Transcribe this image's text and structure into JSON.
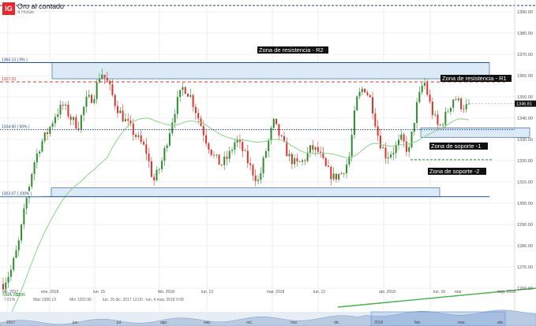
{
  "header": {
    "logo": "IG",
    "title": "Oro al contado",
    "timeframe": "4 Horas"
  },
  "stats": {
    "sma_label": "SMA 200",
    "sma_value": "1286",
    "change": "7,01%",
    "max": "Máx 1366.13",
    "min": "Mín 1252.90",
    "range": "lun. 15 dic. 2017 12:00 - lun. 4 may. 2018 0:00"
  },
  "colors": {
    "candle_up": "#2e8b2e",
    "candle_down": "#d9342b",
    "sma": "#8bd48b",
    "zone_fill": "#dce9f7",
    "zone_stroke": "#1f4f8f",
    "resistance_line": "#d9342b",
    "support_line": "#2e8b2e",
    "trend_line": "#4caf50"
  },
  "chart_data": {
    "type": "candlestick",
    "instrument": "Oro al contado",
    "timeframe": "4 Horas",
    "ylim": [
      1255,
      1395
    ],
    "y_ticks": [
      "1390.00",
      "1380.00",
      "1370.00",
      "1360.00",
      "1350.00",
      "1340.00",
      "1330.00",
      "1320.00",
      "1310.00",
      "1300.00",
      "1290.00",
      "1280.00",
      "1270.00",
      "1260.00"
    ],
    "x_labels": [
      "dic. 2017",
      "ene. 2018",
      "lun. 15",
      "feb. 2018",
      "lun. 12",
      "mar. 2018",
      "lun. 12",
      "abr. 2018",
      "lun. 16",
      "mar.",
      "may. 2018"
    ],
    "nav_labels": [
      "2017",
      "jun.",
      "jul.",
      "ago.",
      "sep.",
      "oct.",
      "nov.",
      "dic.",
      "2018",
      "feb.",
      "mar.",
      "abr."
    ],
    "approx_close_path": [
      1262,
      1268,
      1280,
      1300,
      1318,
      1328,
      1334,
      1342,
      1346,
      1340,
      1336,
      1348,
      1350,
      1362,
      1356,
      1346,
      1340,
      1335,
      1330,
      1325,
      1310,
      1318,
      1332,
      1346,
      1355,
      1350,
      1340,
      1330,
      1322,
      1318,
      1322,
      1330,
      1324,
      1316,
      1310,
      1325,
      1338,
      1330,
      1322,
      1318,
      1320,
      1326,
      1324,
      1316,
      1312,
      1314,
      1320,
      1348,
      1355,
      1348,
      1330,
      1322,
      1325,
      1330,
      1324,
      1345,
      1358,
      1344,
      1335,
      1342,
      1350,
      1346,
      1345
    ],
    "current_price": "1346.81",
    "levels": [
      {
        "label": "1366.13 ( 0% )",
        "value": 1366.13
      },
      {
        "label": "1357.03",
        "value": 1357.03
      },
      {
        "label": "1334.60 ( 50% )",
        "value": 1334.6
      },
      {
        "label": "1303.07 ( 100% )",
        "value": 1303.07
      }
    ],
    "annotations": [
      "Zona de resistencia - R2",
      "Zona de resistencia - R1",
      "Zona de soporte -1",
      "Zona de soporte -2"
    ]
  }
}
